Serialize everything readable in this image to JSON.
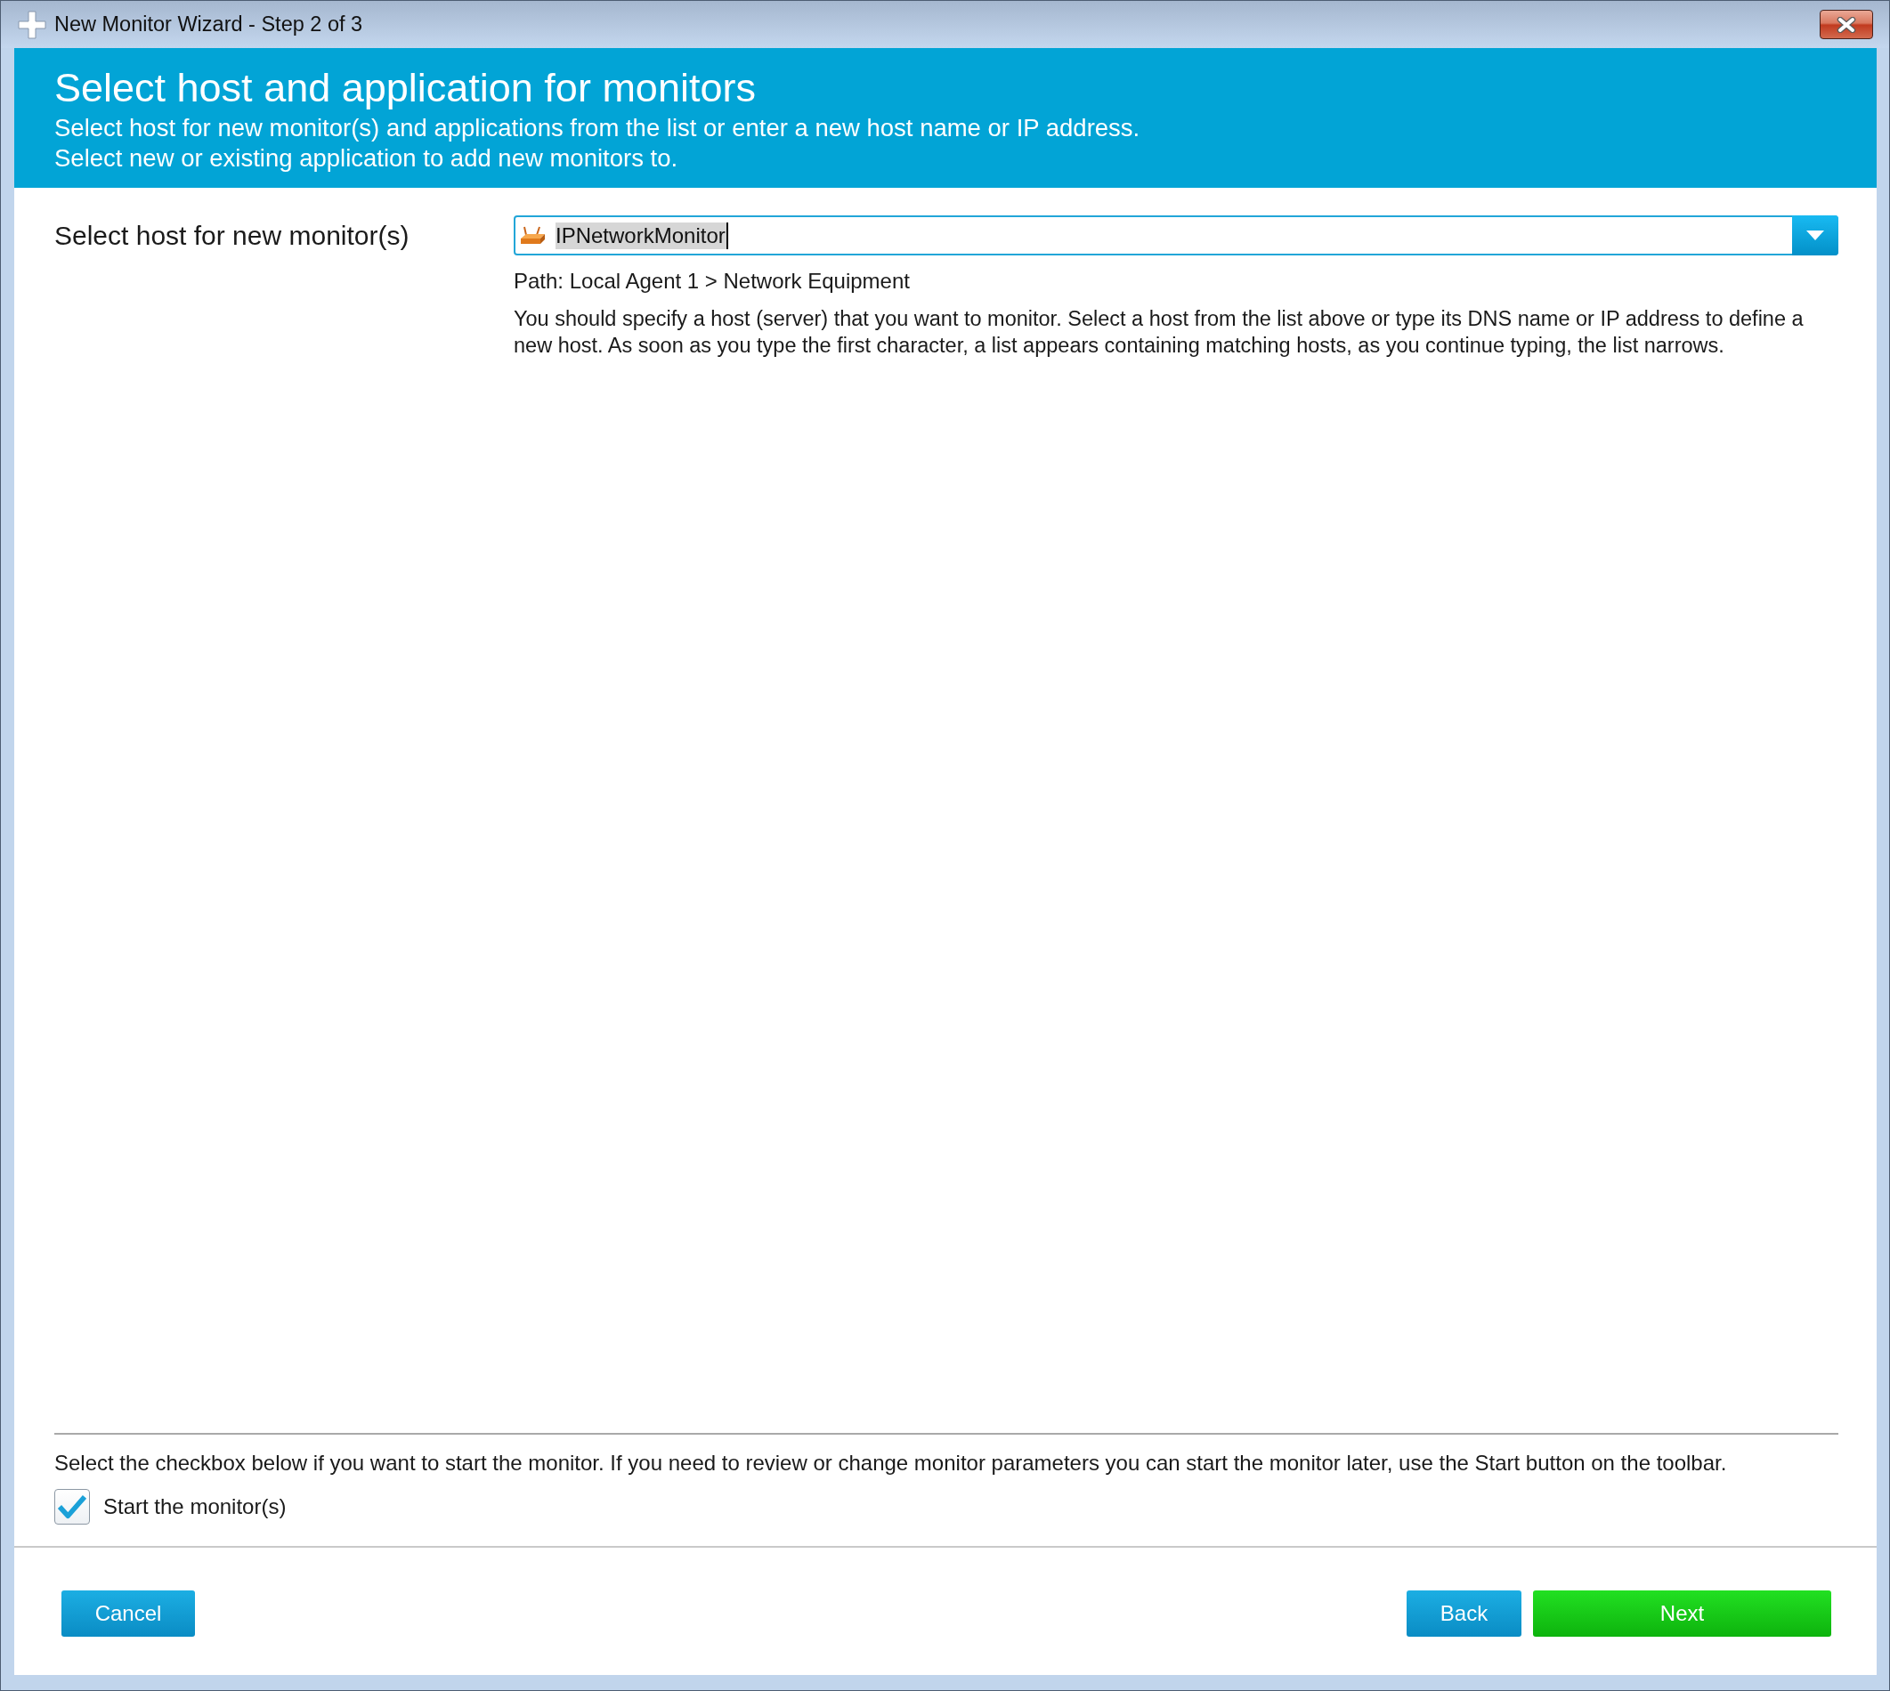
{
  "window": {
    "title": "New Monitor Wizard - Step 2 of 3"
  },
  "header": {
    "title": "Select host and application for monitors",
    "lines": [
      "Select host for new monitor(s) and applications from the list or enter a new host name or IP address.",
      "Select new or existing application to add new monitors to."
    ]
  },
  "host": {
    "label": "Select host for new monitor(s)",
    "value": "IPNetworkMonitor",
    "value_selected": true,
    "path": "Path: Local Agent 1 > Network Equipment",
    "help": "You should specify a host (server) that you want to monitor. Select a host from the list above or type its DNS name or IP address to define a new host. As soon as you type the first character, a list appears containing matching hosts, as you continue typing, the list narrows."
  },
  "start": {
    "note": "Select the checkbox below if you want to start the monitor. If you need to review or change monitor parameters you can start the monitor later, use the Start button on the toolbar.",
    "label": "Start the monitor(s)",
    "checked": true
  },
  "buttons": {
    "cancel": {
      "label": "Cancel",
      "kind": "secondary"
    },
    "back": {
      "label": "Back",
      "kind": "secondary"
    },
    "next": {
      "label": "Next",
      "kind": "primary"
    }
  }
}
